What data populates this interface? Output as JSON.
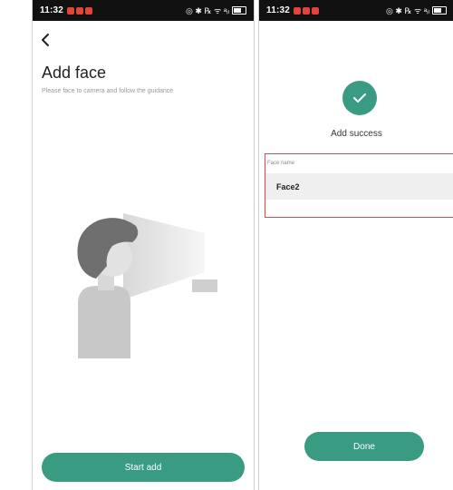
{
  "status_left": {
    "time": "11:32",
    "right_icons": "◎ ✱ ℞ ᯤ ᵃᵢₗ"
  },
  "status_right": {
    "time": "11:32",
    "right_icons": "◎ ✱ ℞ ᯤ ᵃᵢₗ"
  },
  "add_face": {
    "title": "Add face",
    "subtitle": "Please face to camera and follow the guidance",
    "start_button": "Start add"
  },
  "success": {
    "message": "Add success",
    "face_name_label": "Face name",
    "face_name_value": "Face2",
    "done_button": "Done"
  },
  "colors": {
    "accent": "#3a9b83",
    "highlight_border": "#d94a4a"
  },
  "icons": [
    "chevron-left-icon",
    "check-icon",
    "battery-icon",
    "face-scan-illustration"
  ]
}
